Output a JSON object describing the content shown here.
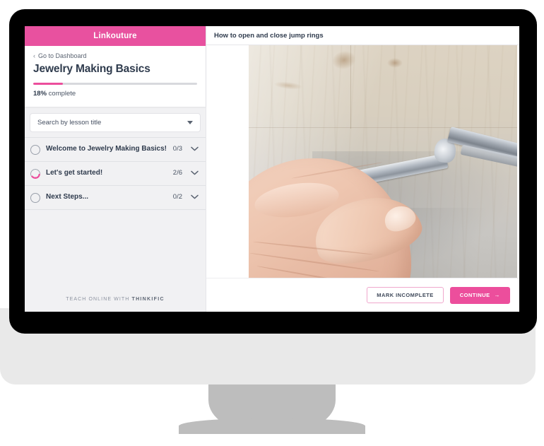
{
  "brand": {
    "name": "Linkouture",
    "accent_color": "#ec4e9c",
    "header_bg": "#e8519f"
  },
  "sidebar": {
    "back_link": {
      "label": "Go to Dashboard",
      "icon": "chevron-left-icon"
    },
    "course_title": "Jewelry Making Basics",
    "progress": {
      "percent": 18,
      "percent_label": "18%",
      "suffix_label": " complete",
      "fill_color": "#ec4e9c",
      "track_color": "#d8d9dd"
    },
    "search": {
      "placeholder": "Search by lesson title",
      "caret_icon": "caret-down-icon"
    },
    "lessons": [
      {
        "title": "Welcome to Jewelry Making Basics!",
        "count": "0/3",
        "status": "not-started",
        "chevron": "chevron-down-icon"
      },
      {
        "title": "Let's get started!",
        "count": "2/6",
        "status": "in-progress",
        "chevron": "chevron-down-icon"
      },
      {
        "title": "Next Steps...",
        "count": "0/2",
        "status": "not-started",
        "chevron": "chevron-down-icon"
      }
    ],
    "footer": {
      "prefix": "TEACH ONLINE WITH ",
      "brand": "THINKIFIC"
    }
  },
  "content": {
    "lesson_heading": "How to open and close jump rings",
    "media": {
      "type": "video-frame",
      "description": "Close-up of a hand holding chain-nose pliers over a light wooden workbench"
    },
    "actions": {
      "mark_incomplete": "MARK INCOMPLETE",
      "continue": "CONTINUE",
      "continue_arrow": "→"
    }
  }
}
